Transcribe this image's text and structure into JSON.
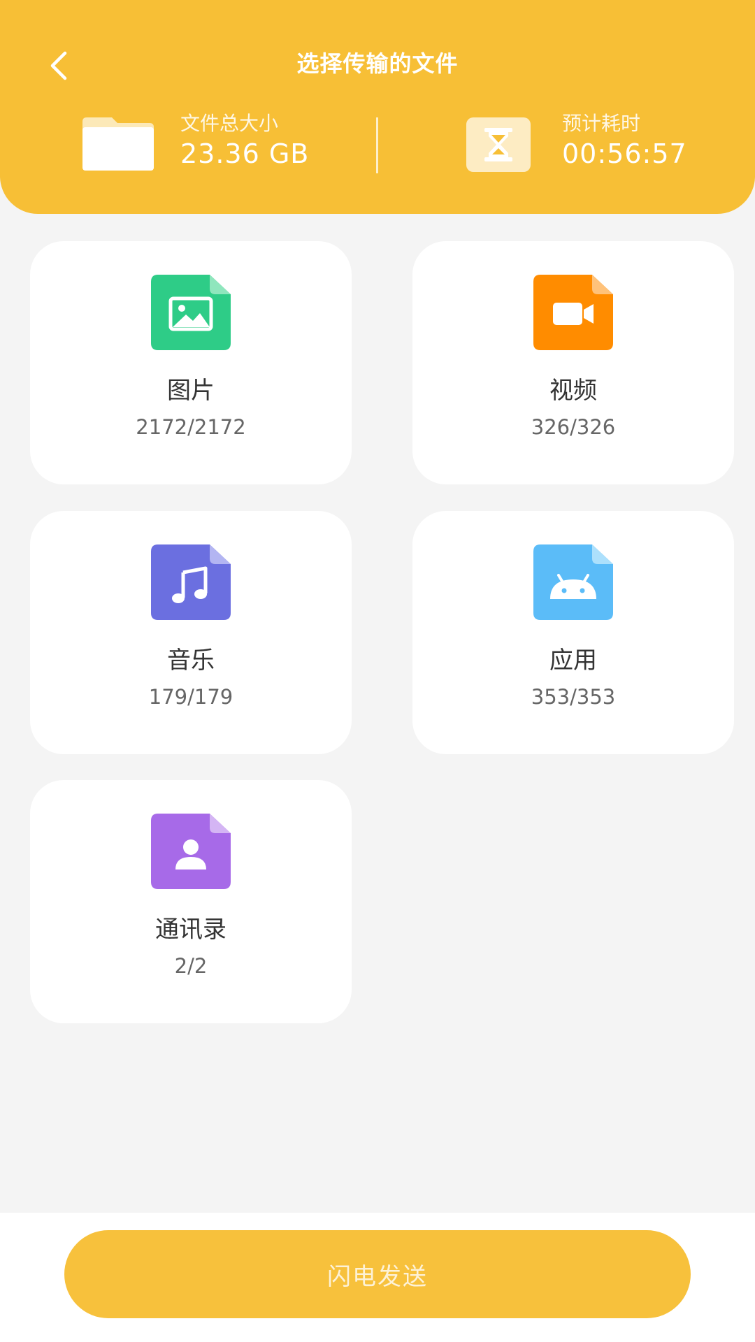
{
  "header": {
    "title": "选择传输的文件",
    "back_icon": "chevron-left-icon",
    "total_size": {
      "label": "文件总大小",
      "value": "23.36 GB",
      "icon": "folder-icon"
    },
    "estimated_time": {
      "label": "预计耗时",
      "value": "00:56:57",
      "icon": "hourglass-icon"
    }
  },
  "categories": [
    {
      "label": "图片",
      "count": "2172/2172",
      "icon": "image-file-icon",
      "color": "#2ecc87"
    },
    {
      "label": "视频",
      "count": "326/326",
      "icon": "video-file-icon",
      "color": "#ff8c00"
    },
    {
      "label": "音乐",
      "count": "179/179",
      "icon": "music-file-icon",
      "color": "#6b6fe0"
    },
    {
      "label": "应用",
      "count": "353/353",
      "icon": "android-file-icon",
      "color": "#5bbcf8"
    },
    {
      "label": "通讯录",
      "count": "2/2",
      "icon": "contact-file-icon",
      "color": "#a76ae8"
    }
  ],
  "footer": {
    "send_label": "闪电发送"
  },
  "colors": {
    "accent": "#f7bf36",
    "background": "#f4f4f4"
  }
}
